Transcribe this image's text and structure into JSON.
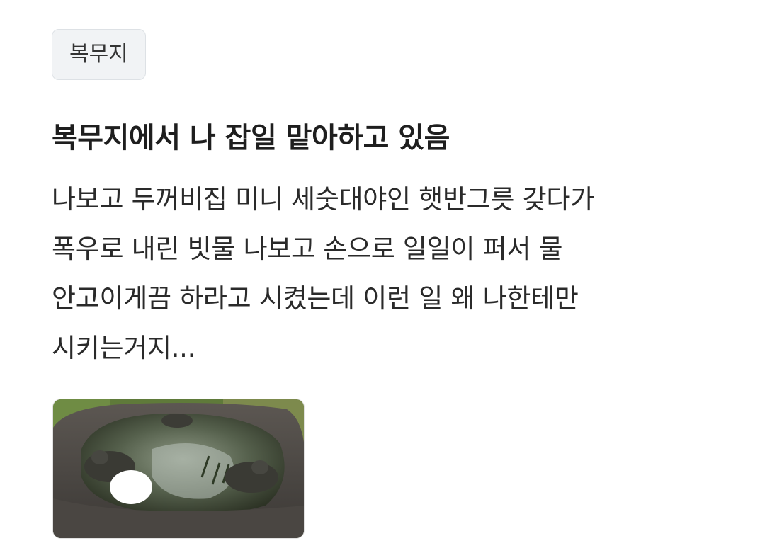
{
  "post": {
    "tag": "복무지",
    "title": "복무지에서 나 잡일 맡아하고 있음",
    "body_lines": [
      "나보고 두꺼비집 미니 세숫대야인 햇반그릇 갖다가",
      "폭우로 내린 빗물 나보고 손으로 일일이 퍼서 물",
      "안고이게끔 하라고 시켰는데 이런 일 왜 나한테만",
      "시키는거지..."
    ]
  },
  "thumbnail": {
    "icon": "stone-basin-with-toad-statues-photo"
  }
}
